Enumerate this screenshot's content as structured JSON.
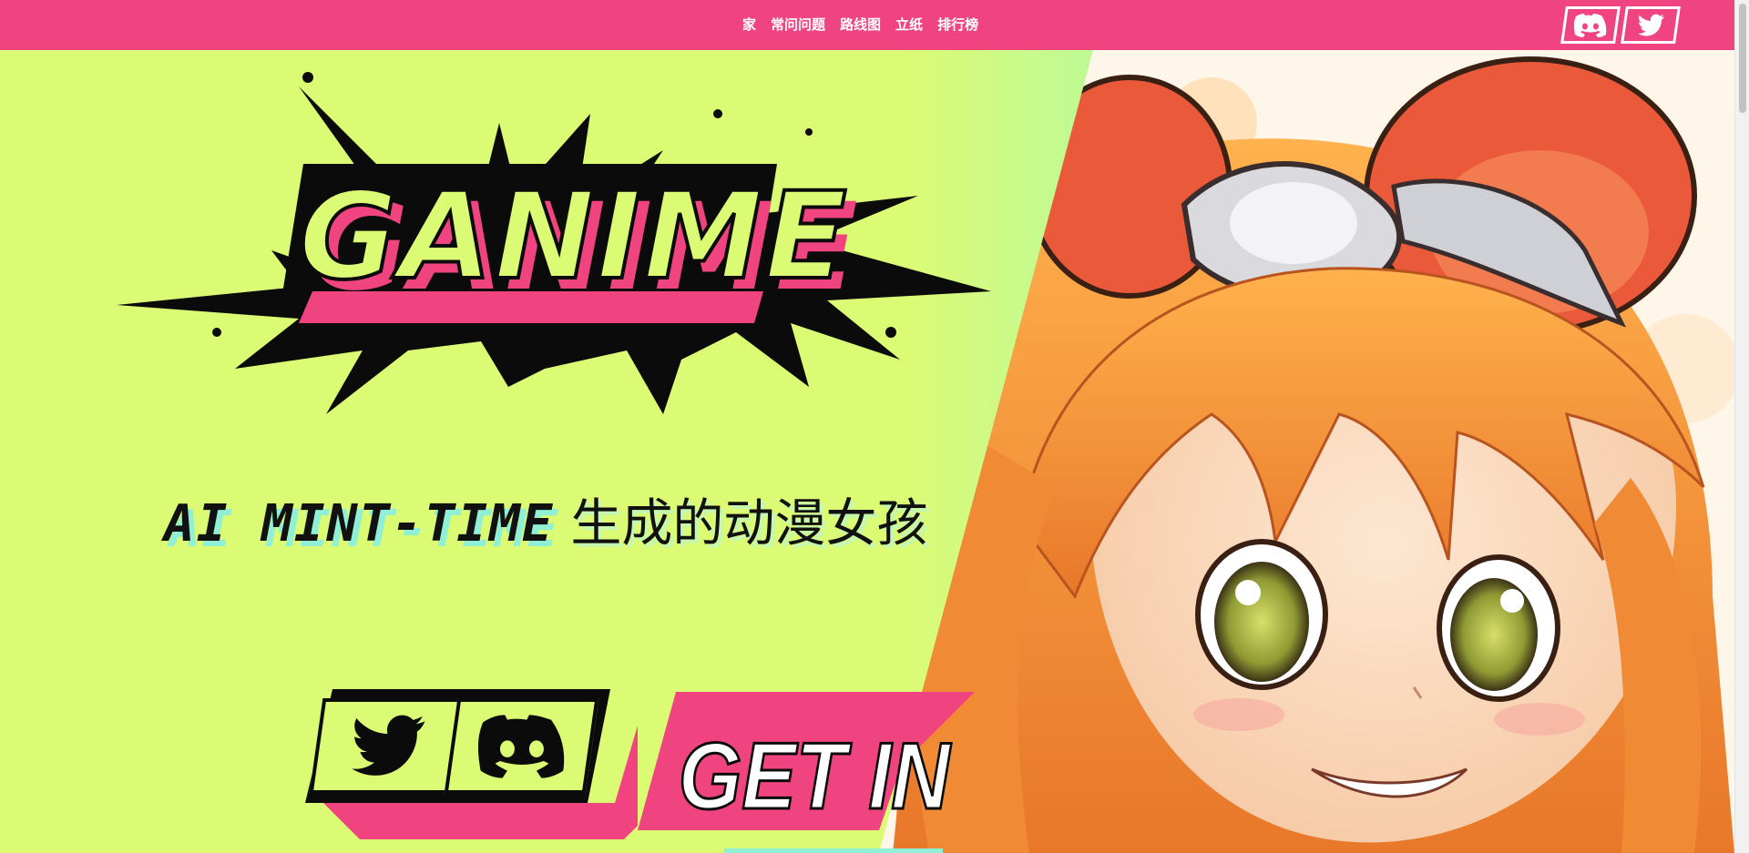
{
  "nav": {
    "items": [
      "家",
      "常问问题",
      "路线图",
      "立纸",
      "排行榜"
    ]
  },
  "hero": {
    "logo_text": "GANIME",
    "tagline_latin": "AI MINT-TIME",
    "tagline_cjk": " 生成的动漫女孩",
    "cta_label": "GET IN"
  },
  "icons": {
    "top_discord": "discord-icon",
    "top_twitter": "twitter-icon",
    "hero_twitter": "twitter-icon",
    "hero_discord": "discord-icon"
  },
  "colors": {
    "brand_pink": "#f04480",
    "lime": "#dcfb74",
    "mint": "#8ff0d6",
    "black": "#111111"
  }
}
